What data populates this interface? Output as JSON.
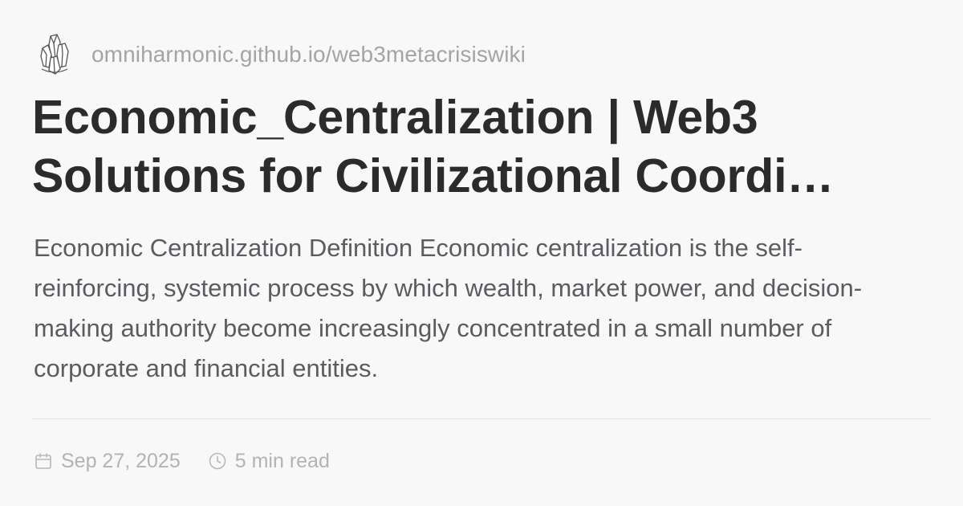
{
  "site": {
    "logo_icon": "crystal-cluster-logo-icon",
    "url": "omniharmonic.github.io/web3metacrisiswiki"
  },
  "article": {
    "title": "Economic_Centralization | Web3 Solutions for Civilizational Coordi…",
    "description": "Economic Centralization Definition Economic centralization is the self-reinforcing, systemic process by which wealth, market power, and decision-making authority become increasingly concentrated in a small number of corporate and financial entities."
  },
  "meta": {
    "date_icon": "calendar-icon",
    "date": "Sep 27, 2025",
    "read_time_icon": "clock-icon",
    "read_time": "5 min read"
  },
  "colors": {
    "background": "#f8f8f9",
    "title": "#2b2b2d",
    "body_text": "#5c5c60",
    "muted_text": "#a4a4a8"
  }
}
